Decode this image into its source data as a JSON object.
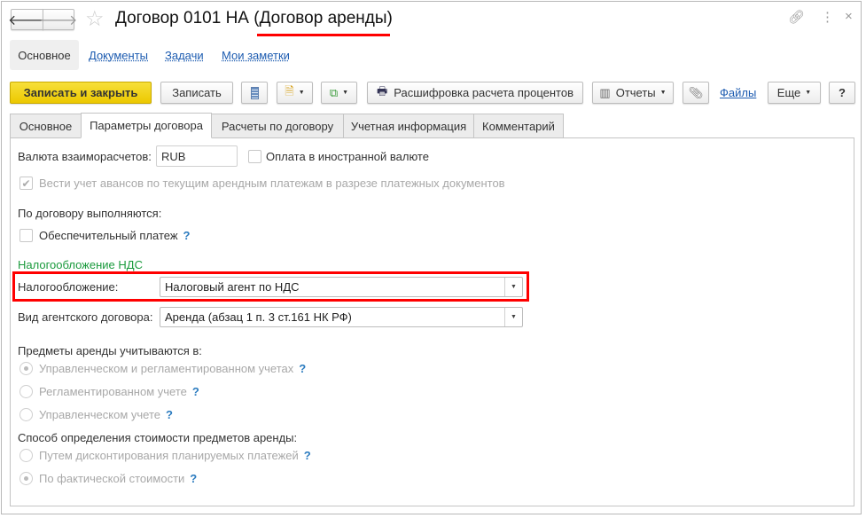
{
  "window": {
    "title": "Договор 0101 НА (Договор аренды)",
    "back_icon": "arrow-left-icon",
    "forward_icon": "arrow-right-icon",
    "favorite_icon": "star-icon",
    "link_icon": "link-icon",
    "more_icon": "more-vertical-icon",
    "close": "×"
  },
  "nav": {
    "items": [
      "Основное",
      "Документы",
      "Задачи",
      "Мои заметки"
    ],
    "active": "Основное"
  },
  "toolbar": {
    "save_close": "Записать и закрыть",
    "save": "Записать",
    "decode": "Расшифровка расчета процентов",
    "reports": "Отчеты",
    "files": "Файлы",
    "more": "Еще",
    "help": "?",
    "accent": "#f2d40c"
  },
  "tabs": [
    "Основное",
    "Параметры договора",
    "Расчеты по договору",
    "Учетная информация",
    "Комментарий"
  ],
  "active_tab": "Параметры договора",
  "form": {
    "currency_label": "Валюта взаиморасчетов:",
    "currency_value": "RUB",
    "foreign_payment": "Оплата в иностранной валюте",
    "foreign_payment_checked": false,
    "advances": "Вести учет авансов по текущим арендным платежам в разрезе платежных документов",
    "advances_checked": true,
    "performed_label": "По договору выполняются:",
    "deposit": "Обеспечительный платеж",
    "deposit_checked": false,
    "vat_group": "Налогообложение НДС",
    "vat_group_color": "#1a9a3c",
    "taxation_label": "Налогообложение:",
    "taxation_value": "Налоговый агент по НДС",
    "agent_label": "Вид агентского договора:",
    "agent_value": "Аренда (абзац 1 п. 3 ст.161 НК РФ)",
    "subjects_label": "Предметы аренды учитываются в:",
    "subjects_options": [
      "Управленческом и регламентированном учетах",
      "Регламентированном учете",
      "Управленческом учете"
    ],
    "subjects_selected": 0,
    "cost_label": "Способ определения стоимости предметов аренды:",
    "cost_options": [
      "Путем дисконтирования планируемых платежей",
      "По фактической стоимости"
    ],
    "cost_selected": 1,
    "help": "?"
  },
  "highlight_color": "#ff0000"
}
